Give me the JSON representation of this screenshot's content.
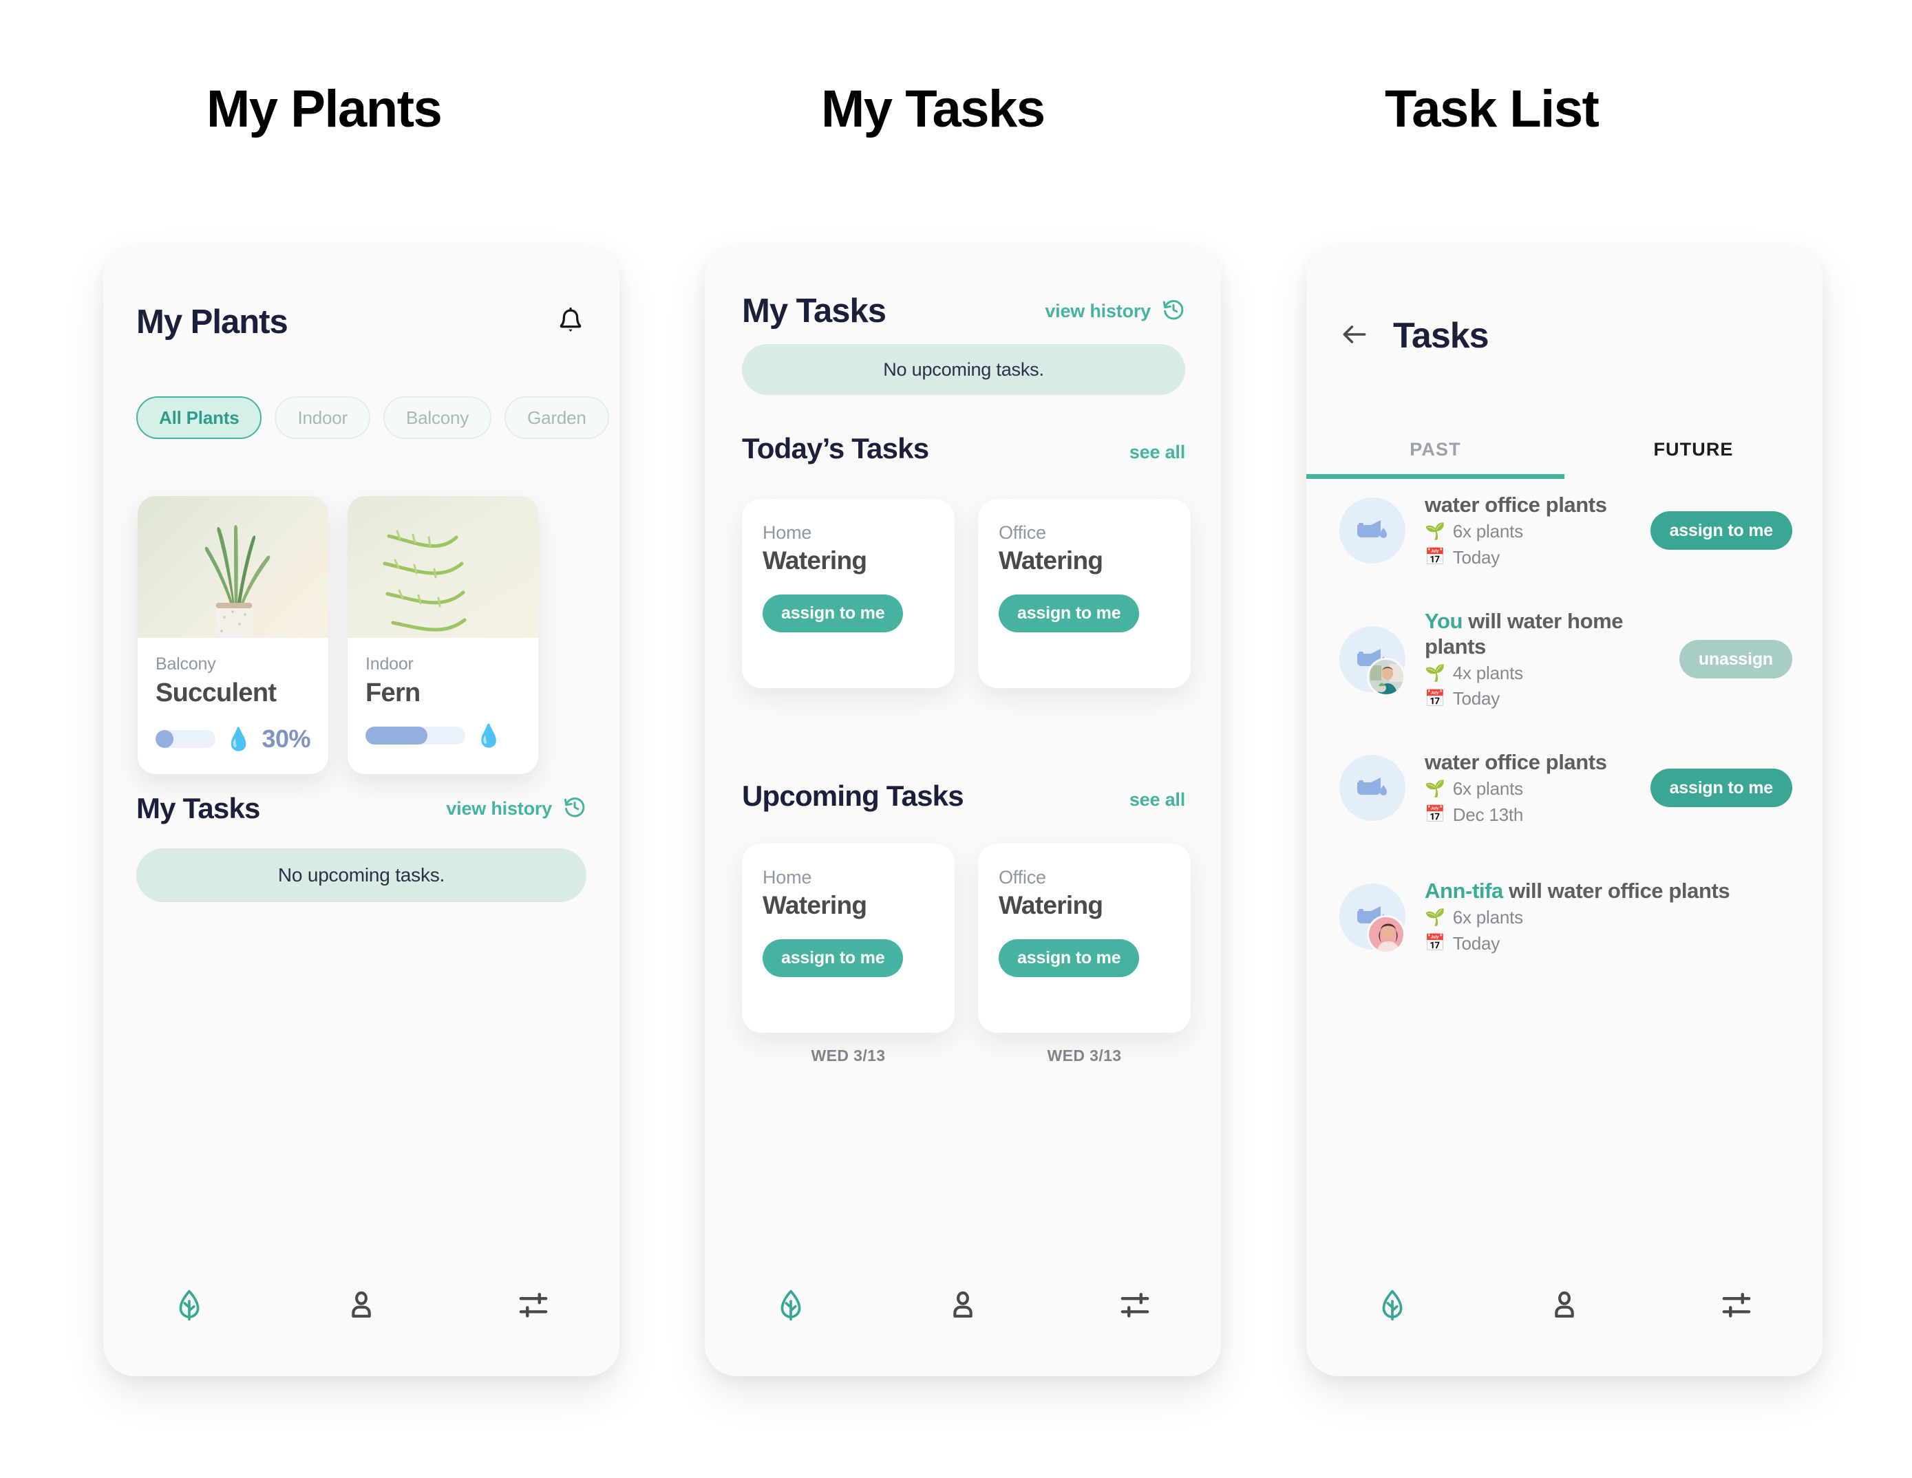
{
  "columns": [
    {
      "title": "My Plants"
    },
    {
      "title": "My Tasks"
    },
    {
      "title": "Task List"
    }
  ],
  "colors": {
    "teal": "#45b3a0",
    "teal_dark": "#2b9d89",
    "teal_muted": "#a7cdc6",
    "navy": "#1b1f3b",
    "pill_bg": "#d8ebe6",
    "progress_fill": "#95aee0",
    "progress_track": "#eaf1fb",
    "avatar_bg": "#e4eefb"
  },
  "screen_plants": {
    "header_title": "My Plants",
    "notification_icon": "bell-icon",
    "filters": [
      {
        "label": "All Plants",
        "active": true
      },
      {
        "label": "Indoor",
        "active": false
      },
      {
        "label": "Balcony",
        "active": false
      },
      {
        "label": "Garden",
        "active": false
      }
    ],
    "plants": [
      {
        "location": "Balcony",
        "name": "Succulent",
        "moisture_pct": "30%",
        "moisture_value": 30,
        "drop_icon": "water-drop-icon"
      },
      {
        "location": "Indoor",
        "name": "Fern",
        "moisture_pct": "",
        "moisture_value": 62,
        "drop_icon": "water-drop-icon"
      }
    ],
    "tasks_section": {
      "title": "My Tasks",
      "history_link": "view history",
      "history_icon": "history-icon",
      "empty_text": "No upcoming tasks."
    },
    "nav": [
      {
        "icon": "leaf-icon",
        "active": true
      },
      {
        "icon": "person-icon",
        "active": false
      },
      {
        "icon": "sliders-icon",
        "active": false
      }
    ]
  },
  "screen_tasks": {
    "header_title": "My Tasks",
    "history_link": "view history",
    "history_icon": "history-icon",
    "empty_text": "No upcoming tasks.",
    "sections": [
      {
        "title": "Today’s Tasks",
        "see_all": "see all",
        "cards": [
          {
            "location": "Home",
            "title": "Watering",
            "button": "assign to me",
            "date": ""
          },
          {
            "location": "Office",
            "title": "Watering",
            "button": "assign to me",
            "date": ""
          }
        ]
      },
      {
        "title": "Upcoming Tasks",
        "see_all": "see all",
        "cards": [
          {
            "location": "Home",
            "title": "Watering",
            "button": "assign to me",
            "date": "WED 3/13"
          },
          {
            "location": "Office",
            "title": "Watering",
            "button": "assign to me",
            "date": "WED 3/13"
          }
        ]
      }
    ],
    "nav": [
      {
        "icon": "leaf-icon",
        "active": true
      },
      {
        "icon": "person-icon",
        "active": false
      },
      {
        "icon": "sliders-icon",
        "active": false
      }
    ]
  },
  "screen_tasklist": {
    "back_icon": "arrow-left-icon",
    "title": "Tasks",
    "tabs": [
      {
        "label": "PAST",
        "active": true
      },
      {
        "label": "FUTURE",
        "active": false
      }
    ],
    "rows": [
      {
        "who": "",
        "text": "water office plants",
        "plants": "6x plants",
        "date": "Today",
        "button": "assign to me",
        "button_state": "assign",
        "task_icon": "watering-can-icon",
        "plant_icon": "seedling-icon",
        "date_icon": "calendar-icon",
        "has_person": false,
        "person_variant": ""
      },
      {
        "who": "You",
        "text": " will water home plants",
        "plants": "4x plants",
        "date": "Today",
        "button": "unassign",
        "button_state": "unassign",
        "task_icon": "watering-can-icon",
        "plant_icon": "seedling-icon",
        "date_icon": "calendar-icon",
        "has_person": true,
        "person_variant": "you"
      },
      {
        "who": "",
        "text": "water office plants",
        "plants": "6x plants",
        "date": "Dec 13th",
        "button": "assign to me",
        "button_state": "assign",
        "task_icon": "watering-can-icon",
        "plant_icon": "seedling-icon",
        "date_icon": "calendar-icon",
        "has_person": false,
        "person_variant": ""
      },
      {
        "who": "Ann-tifa",
        "text": " will water office plants",
        "plants": "6x plants",
        "date": "Today",
        "button": "",
        "button_state": "none",
        "task_icon": "watering-can-icon",
        "plant_icon": "seedling-icon",
        "date_icon": "calendar-icon",
        "has_person": true,
        "person_variant": "ann"
      }
    ],
    "nav": [
      {
        "icon": "leaf-icon",
        "active": true
      },
      {
        "icon": "person-icon",
        "active": false
      },
      {
        "icon": "sliders-icon",
        "active": false
      }
    ]
  }
}
